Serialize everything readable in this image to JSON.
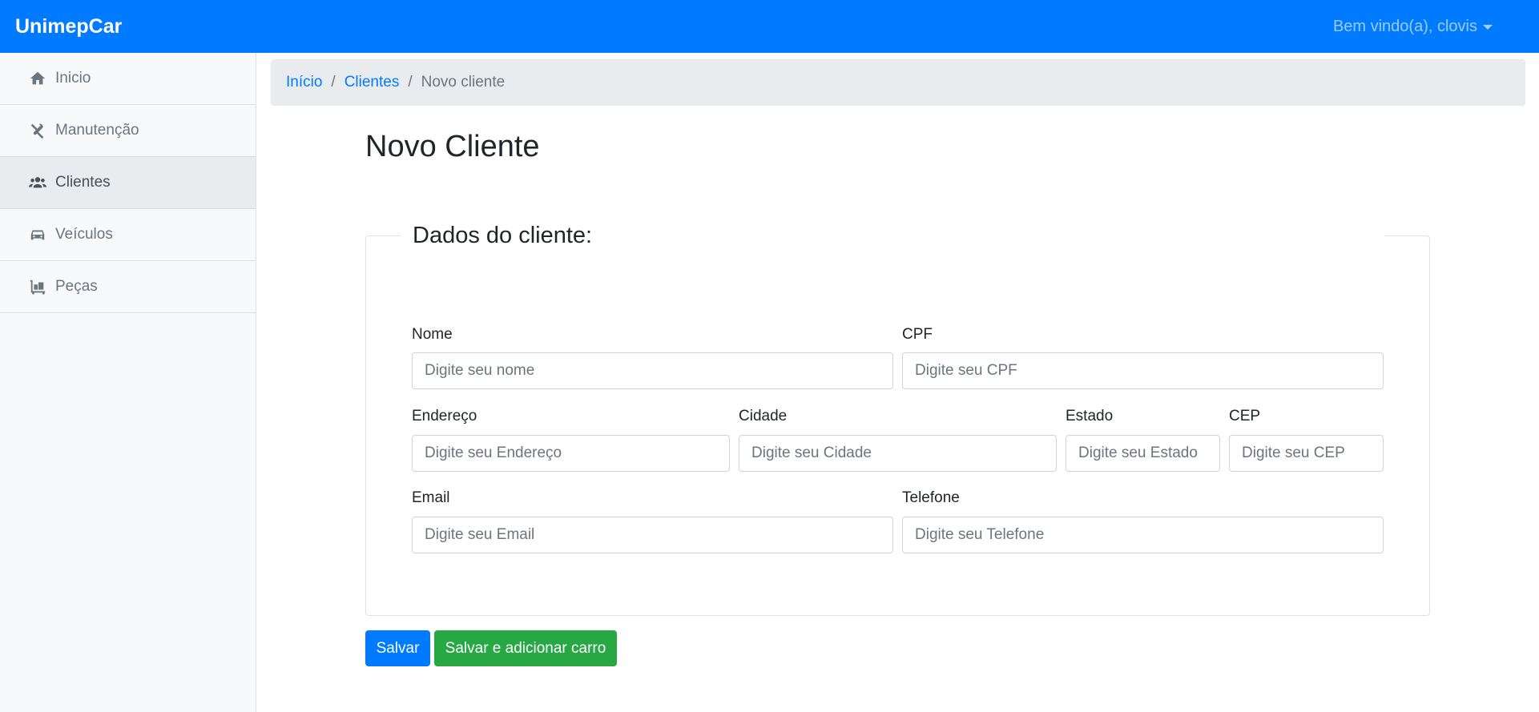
{
  "navbar": {
    "brand": "UnimepCar",
    "user_menu": "Bem vindo(a), clovis",
    "color": "#007bff"
  },
  "sidebar": {
    "items": [
      {
        "label": "Inicio",
        "icon": "home-icon",
        "active": false
      },
      {
        "label": "Manutenção",
        "icon": "tools-icon",
        "active": false
      },
      {
        "label": "Clientes",
        "icon": "users-icon",
        "active": true
      },
      {
        "label": "Veículos",
        "icon": "car-icon",
        "active": false
      },
      {
        "label": "Peças",
        "icon": "dolly-icon",
        "active": false
      }
    ]
  },
  "breadcrumb": {
    "items": [
      "Início",
      "Clientes"
    ],
    "current": "Novo cliente",
    "separator": "/"
  },
  "page": {
    "title": "Novo Cliente"
  },
  "form": {
    "legend": "Dados do cliente:",
    "fields": {
      "nome": {
        "label": "Nome",
        "placeholder": "Digite seu nome",
        "value": ""
      },
      "cpf": {
        "label": "CPF",
        "placeholder": "Digite seu CPF",
        "value": ""
      },
      "endereco": {
        "label": "Endereço",
        "placeholder": "Digite seu Endereço",
        "value": ""
      },
      "cidade": {
        "label": "Cidade",
        "placeholder": "Digite seu Cidade",
        "value": ""
      },
      "estado": {
        "label": "Estado",
        "placeholder": "Digite seu Estado",
        "value": ""
      },
      "cep": {
        "label": "CEP",
        "placeholder": "Digite seu CEP",
        "value": ""
      },
      "email": {
        "label": "Email",
        "placeholder": "Digite seu Email",
        "value": ""
      },
      "telefone": {
        "label": "Telefone",
        "placeholder": "Digite seu Telefone",
        "value": ""
      }
    }
  },
  "actions": {
    "save": "Salvar",
    "save_add_car": "Salvar e adicionar carro",
    "save_color": "#007bff",
    "save_add_car_color": "#28a745"
  }
}
